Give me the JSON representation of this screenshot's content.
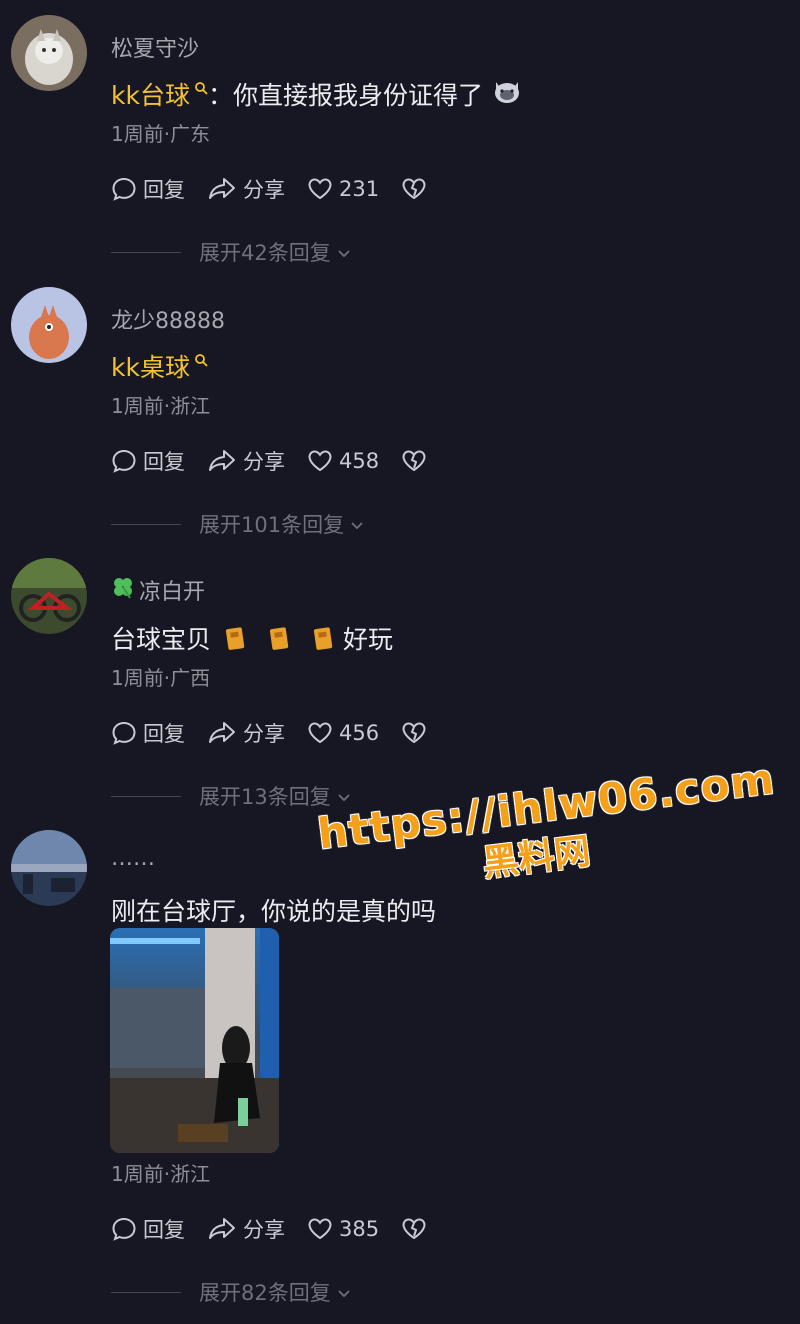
{
  "comments": [
    {
      "username": "松夏守沙",
      "mention": "kk台球",
      "text": "：你直接报我身份证得了",
      "meta": "1周前·广东",
      "reply_label": "回复",
      "share_label": "分享",
      "likes": "231",
      "expand_label": "展开42条回复"
    },
    {
      "username": "龙少88888",
      "mention": "kk桌球",
      "text": "",
      "meta": "1周前·浙江",
      "reply_label": "回复",
      "share_label": "分享",
      "likes": "458",
      "expand_label": "展开101条回复"
    },
    {
      "username": "凉白开",
      "text_part1": "台球宝贝",
      "text_part2": "好玩",
      "meta": "1周前·广西",
      "reply_label": "回复",
      "share_label": "分享",
      "likes": "456",
      "expand_label": "展开13条回复"
    },
    {
      "username": "……",
      "text": "刚在台球厅，你说的是真的吗",
      "meta": "1周前·浙江",
      "reply_label": "回复",
      "share_label": "分享",
      "likes": "385",
      "expand_label": "展开82条回复"
    }
  ],
  "watermark": {
    "url": "https://ihlw06.com",
    "name": "黑料网"
  },
  "colors": {
    "background": "#161722",
    "mention": "#f2c230",
    "watermark": "#f5a01a"
  },
  "icons": {
    "reply": "comment-bubble-icon",
    "share": "share-arrow-icon",
    "like": "heart-icon",
    "dislike": "broken-heart-icon",
    "mention_search": "search-icon",
    "clover": "four-leaf-clover-icon",
    "ticket": "ticket-emoji-icon",
    "cat": "cat-emoji-icon",
    "chevron": "chevron-down-icon"
  }
}
